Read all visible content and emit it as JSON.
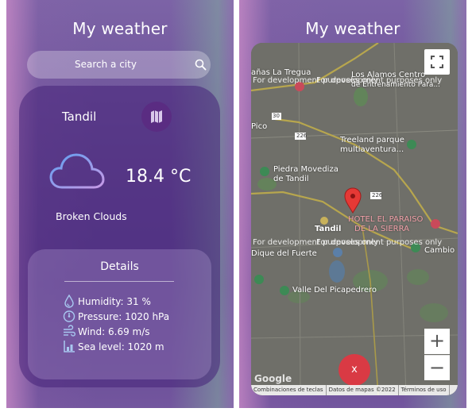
{
  "left_screen": {
    "title": "My weather",
    "search": {
      "placeholder": "Search a city",
      "icon": "search-icon"
    },
    "weather": {
      "city": "Tandil",
      "map_button_icon": "map-icon",
      "icon": "cloud-icon",
      "temperature": "18.4 °C",
      "description": "Broken Clouds"
    },
    "details": {
      "title": "Details",
      "items": [
        {
          "icon": "droplet-icon",
          "text": "Humidity: 31 %"
        },
        {
          "icon": "gauge-icon",
          "text": "Pressure: 1020 hPa"
        },
        {
          "icon": "wind-icon",
          "text": "Wind: 6.69 m/s"
        },
        {
          "icon": "sea-level-icon",
          "text": "Sea level: 1020 m"
        }
      ]
    }
  },
  "right_screen": {
    "title": "My weather",
    "map": {
      "dev_notice": "For development purposes only",
      "places": {
        "la_tregua": "añas La Tregua",
        "los_alamos": "Los Alamos Centro",
        "los_alamos_2": "de Entrenamiento Para...",
        "pico": "Pico",
        "freeland_1": "Treeland parque",
        "freeland_2": "multiaventura...",
        "piedra_1": "Piedra Movediza",
        "piedra_2": "de Tandil",
        "hotel_1": "HOTEL EL PARAISO",
        "hotel_2": "DE LA SIERRA",
        "tandil": "Tandil",
        "dique": "Dique del Fuerte",
        "cambio": "Cambio",
        "picapedrero": "Valle Del Picapedrero"
      },
      "road_numbers": [
        "30",
        "226",
        "226"
      ],
      "fullscreen_icon": "fullscreen-icon",
      "zoom_in": "+",
      "zoom_out": "−",
      "close_label": "x",
      "google_logo": "Google",
      "attribution": [
        "Combinaciones de teclas",
        "Datos de mapas ©2022",
        "Términos de uso"
      ]
    }
  }
}
